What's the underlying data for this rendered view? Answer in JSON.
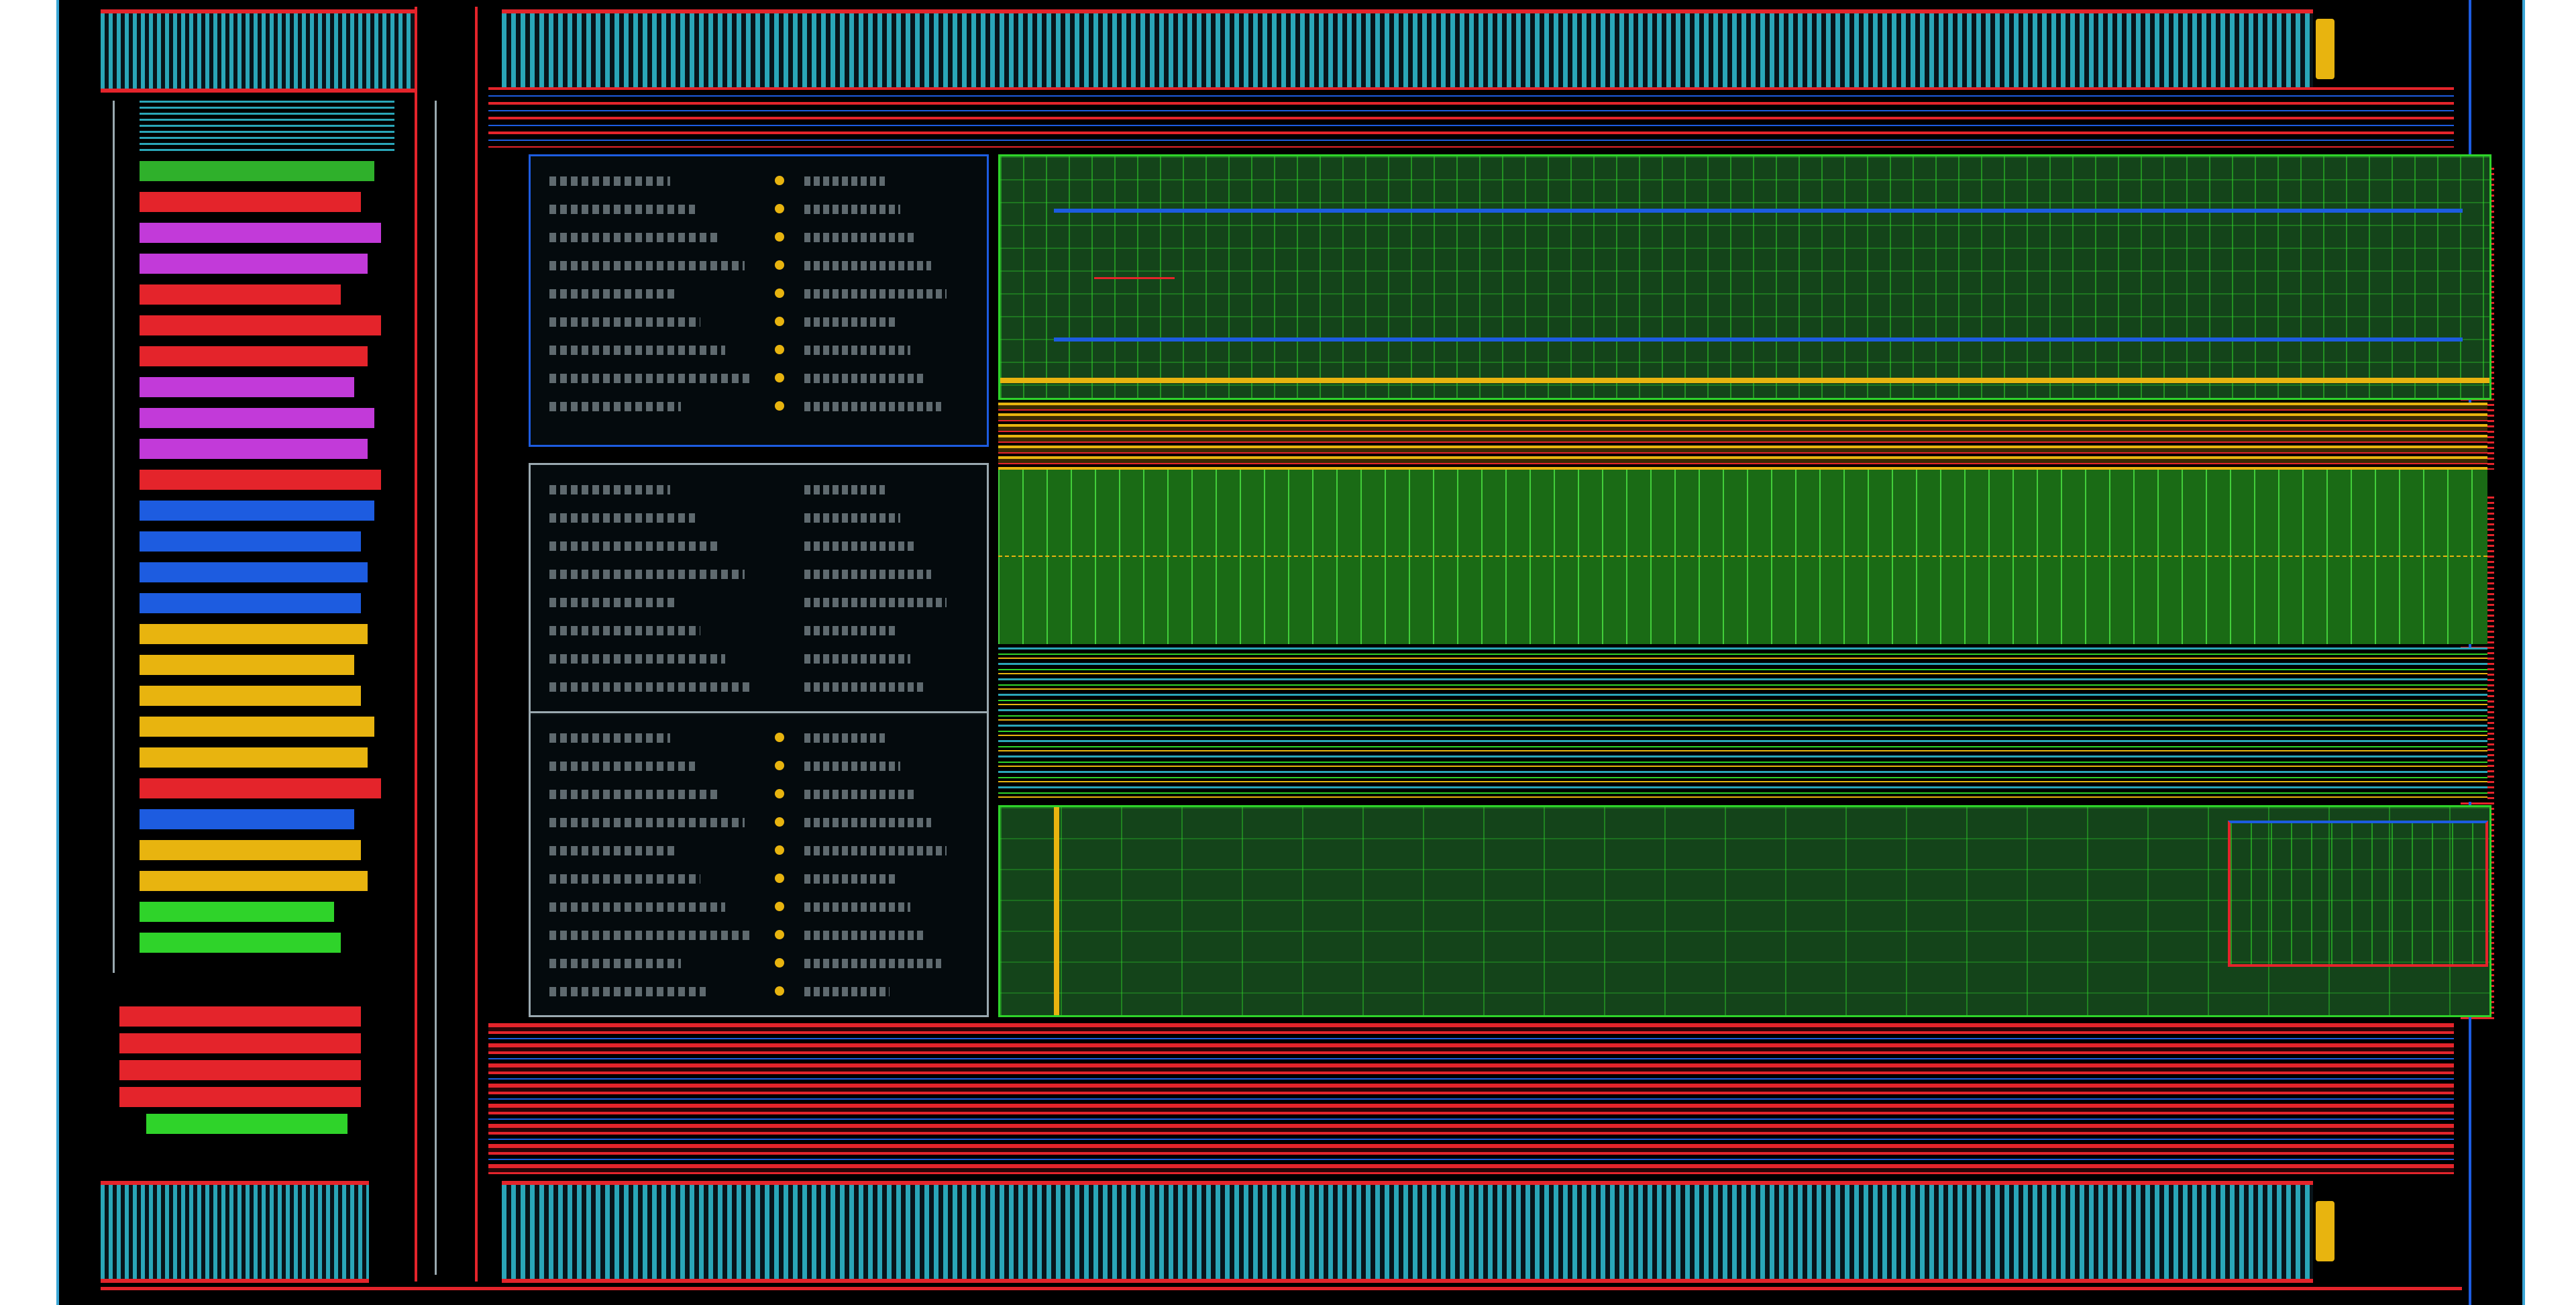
{
  "colors": {
    "background": "#000000",
    "frame": "#3aa6d6",
    "bus_red": "#e4242b",
    "pad_cyan": "#2aa6b8",
    "logic_green": "#1f8a1a",
    "grid_green": "#2fd32a",
    "gold": "#e8b40f",
    "blue": "#1d5ce0",
    "magenta": "#c23ad9"
  },
  "icons": {
    "top_led": "pad-indicator-icon",
    "bottom_led": "pad-indicator-icon",
    "panel_dot": "status-dot-icon"
  },
  "legend_colors": [
    "#2fb02b",
    "#e4242b",
    "#c23ad9",
    "#c23ad9",
    "#e4242b",
    "#e4242b",
    "#e4242b",
    "#c23ad9",
    "#c23ad9",
    "#c23ad9",
    "#e4242b",
    "#1d5ce0",
    "#1d5ce0",
    "#1d5ce0",
    "#1d5ce0",
    "#e8b40f",
    "#e8b40f",
    "#e8b40f",
    "#e8b40f",
    "#e8b40f",
    "#e4242b",
    "#1d5ce0",
    "#e8b40f",
    "#e8b40f",
    "#2fd32a",
    "#2fd32a"
  ],
  "lower_legend_colors": [
    "#e4242b",
    "#e4242b",
    "#e4242b",
    "#e4242b",
    "#2fd32a"
  ]
}
